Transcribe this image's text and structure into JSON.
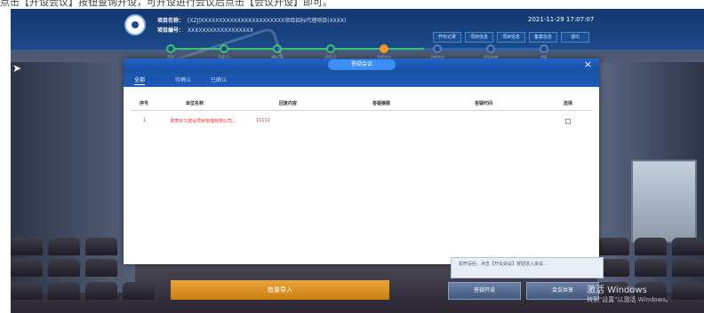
{
  "caption": "点击【开设会议】按钮查询开设，可开设进行会议后点击【会议开设】即可。",
  "header": {
    "project_name_label": "项目名称：",
    "project_name": "[XZJ]XXXXXXXXXXXXXXXXXXXXXXX项目招标代理项目(XXXX)",
    "project_code_label": "项目编号：",
    "project_code": "XXXXXXXXXXXXXXXXXX",
    "datetime": "2021-11-29   17:07:07",
    "buttons": [
      "开标记录",
      "项目信息",
      "项目信息",
      "备案信息",
      "退出"
    ]
  },
  "progress": {
    "steps": [
      "签到",
      "开标(1)",
      "唱标(1)",
      "评标(1)",
      "答疑会议",
      "评审会议",
      "开标结束",
      "定标"
    ],
    "current_index": 4
  },
  "modal": {
    "title": "答疑会议",
    "close": "×",
    "tabs": [
      "全部",
      "待确认",
      "已确认"
    ],
    "active_tab": 0,
    "columns": [
      "序号",
      "单位名称",
      "回复内容",
      "答疑摘要",
      "答疑时间",
      "选择"
    ],
    "rows": [
      {
        "index": "1",
        "unit_name": "甘肃中工建设项目管理有限公司...",
        "reply": "11111",
        "summary": "",
        "time": "",
        "checked": false
      }
    ]
  },
  "notice": "如开设后，点击【开设会议】按钮进入会议...",
  "footer": {
    "confirm_button": "批量导入",
    "open_meeting_button": "答疑开设",
    "share_screen_button": "会议共享"
  },
  "watermark": {
    "line1": "激活 Windows",
    "line2": "转到\"设置\"以激活 Windows。"
  },
  "colors": {
    "header_blue": "#13386f",
    "accent_blue": "#1e64c8",
    "progress_done": "#38c46a",
    "progress_current": "#f39a1e",
    "row_text": "#e12a2a",
    "confirm_orange": "#d88d22"
  },
  "icons": [
    "logo-icon",
    "arrow-icon",
    "close-icon",
    "checkbox-icon"
  ]
}
